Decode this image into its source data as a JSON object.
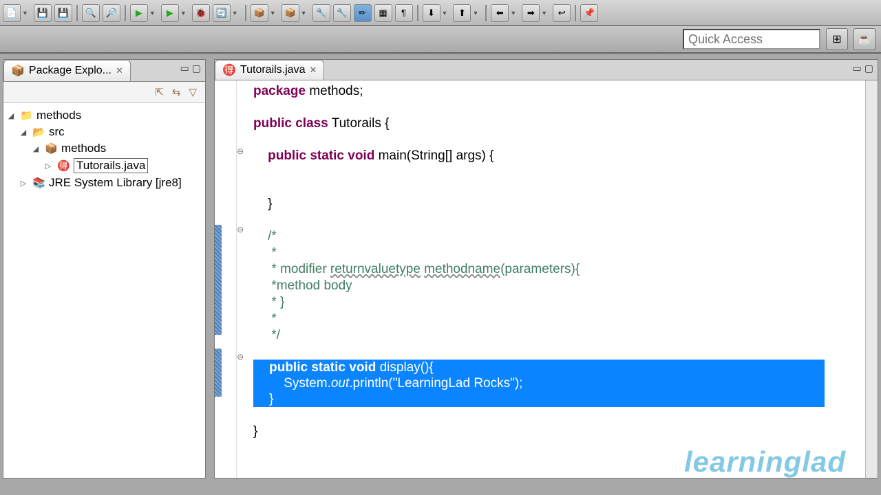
{
  "toolbar": {
    "icons": [
      "📄",
      "💾",
      "🖨",
      "🔍",
      "🔎",
      "▶",
      "▶",
      "🐞",
      "🐞",
      "🔄",
      "📂",
      "📂",
      "🔧",
      "🔧",
      "🔧",
      "✏",
      "📋",
      "📑",
      "⬇",
      "⬆",
      "⬅",
      "➡",
      "↩",
      "|",
      "📦"
    ]
  },
  "quick_access_placeholder": "Quick Access",
  "package_explorer": {
    "title": "Package Explo...",
    "tree": {
      "project": "methods",
      "src": "src",
      "package": "methods",
      "file": "Tutorails.java",
      "jre": "JRE System Library [jre8]"
    }
  },
  "editor": {
    "tab": "Tutorails.java",
    "code": {
      "l1a": "package",
      "l1b": " methods;",
      "l2a": "public",
      "l2b": " class",
      "l2c": " Tutorails {",
      "l3a": "    public",
      "l3b": " static",
      "l3c": " void",
      "l3d": " main(String[] args) {",
      "l4": "    }",
      "c1": "    /*",
      "c2": "     *",
      "c3a": "     * modifier ",
      "c3b": "returnvaluetype",
      "c3c": " ",
      "c3d": "methodname",
      "c3e": "(parameters){",
      "c4": "     *method body",
      "c5": "     * }",
      "c6": "     *",
      "c7": "     */",
      "s1a": "    public",
      "s1b": " static",
      "s1c": " void",
      "s1d": " display(){",
      "s2a": "        System.",
      "s2b": "out",
      "s2c": ".println(",
      "s2d": "\"LearningLad Rocks\"",
      "s2e": ");",
      "s3": "    }",
      "l5": "}"
    }
  },
  "watermark": "learninglad"
}
